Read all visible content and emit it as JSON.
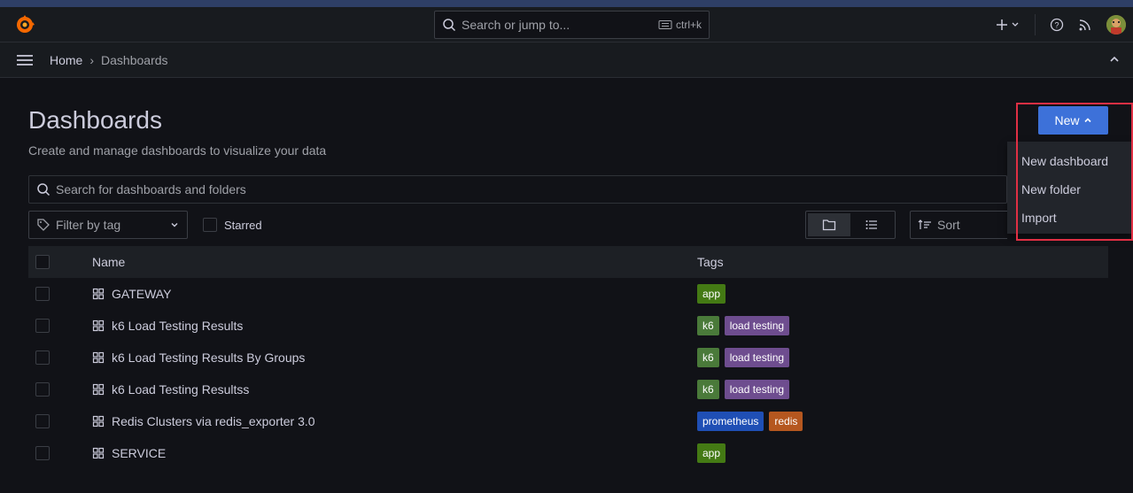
{
  "search": {
    "placeholder": "Search or jump to...",
    "shortcut": "ctrl+k"
  },
  "breadcrumb": {
    "home": "Home",
    "separator": "›",
    "current": "Dashboards"
  },
  "page": {
    "title": "Dashboards",
    "subtitle": "Create and manage dashboards to visualize your data"
  },
  "new_button": {
    "label": "New"
  },
  "new_menu": {
    "items": [
      {
        "label": "New dashboard"
      },
      {
        "label": "New folder"
      },
      {
        "label": "Import"
      }
    ]
  },
  "filters": {
    "search_placeholder": "Search for dashboards and folders",
    "tag_placeholder": "Filter by tag",
    "starred_label": "Starred",
    "sort_placeholder": "Sort"
  },
  "table": {
    "headers": {
      "name": "Name",
      "tags": "Tags"
    },
    "rows": [
      {
        "name": "GATEWAY",
        "tags": [
          {
            "label": "app",
            "color": "#447a14"
          }
        ]
      },
      {
        "name": "k6 Load Testing Results",
        "tags": [
          {
            "label": "k6",
            "color": "#4a7a3a"
          },
          {
            "label": "load testing",
            "color": "#6e4d8f"
          }
        ]
      },
      {
        "name": "k6 Load Testing Results By Groups",
        "tags": [
          {
            "label": "k6",
            "color": "#4a7a3a"
          },
          {
            "label": "load testing",
            "color": "#6e4d8f"
          }
        ]
      },
      {
        "name": "k6 Load Testing Resultss",
        "tags": [
          {
            "label": "k6",
            "color": "#4a7a3a"
          },
          {
            "label": "load testing",
            "color": "#6e4d8f"
          }
        ]
      },
      {
        "name": "Redis Clusters via redis_exporter 3.0",
        "tags": [
          {
            "label": "prometheus",
            "color": "#1f4fb5"
          },
          {
            "label": "redis",
            "color": "#b5571f"
          }
        ]
      },
      {
        "name": "SERVICE",
        "tags": [
          {
            "label": "app",
            "color": "#447a14"
          }
        ]
      }
    ]
  },
  "colors": {
    "accent": "#3d71d9",
    "highlight": "#e02f44",
    "background": "#111217"
  }
}
